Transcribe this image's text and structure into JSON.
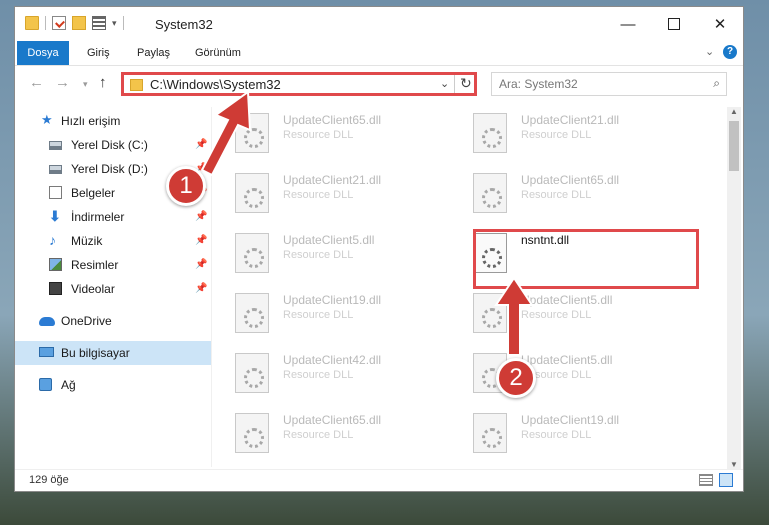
{
  "window": {
    "title": "System32"
  },
  "ribbon": {
    "tabs": [
      "Dosya",
      "Giriş",
      "Paylaş",
      "Görünüm"
    ],
    "help_label": "?"
  },
  "nav": {
    "address": "C:\\Windows\\System32",
    "search_placeholder": "Ara: System32"
  },
  "sidebar": {
    "quick_access": "Hızlı erişim",
    "items": [
      {
        "label": "Yerel Disk (C:)",
        "icon": "drive-icon"
      },
      {
        "label": "Yerel Disk (D:)",
        "icon": "drive-icon"
      },
      {
        "label": "Belgeler",
        "icon": "documents-icon"
      },
      {
        "label": "İndirmeler",
        "icon": "download-icon"
      },
      {
        "label": "Müzik",
        "icon": "music-icon"
      },
      {
        "label": "Resimler",
        "icon": "pictures-icon"
      },
      {
        "label": "Videolar",
        "icon": "videos-icon"
      }
    ],
    "onedrive": "OneDrive",
    "this_pc": "Bu bilgisayar",
    "network": "Ağ"
  },
  "files": {
    "left_column": [
      {
        "name": "UpdateClient65.dll",
        "type": "Resource DLL"
      },
      {
        "name": "UpdateClient21.dll",
        "type": "Resource DLL"
      },
      {
        "name": "UpdateClient5.dll",
        "type": "Resource DLL"
      },
      {
        "name": "UpdateClient19.dll",
        "type": "Resource DLL"
      },
      {
        "name": "UpdateClient42.dll",
        "type": "Resource DLL"
      },
      {
        "name": "UpdateClient65.dll",
        "type": "Resource DLL"
      }
    ],
    "right_column": [
      {
        "name": "UpdateClient21.dll",
        "type": "Resource DLL"
      },
      {
        "name": "UpdateClient65.dll",
        "type": "Resource DLL"
      },
      {
        "name": "nsntnt.dll",
        "type": ""
      },
      {
        "name": "UpdateClient5.dll",
        "type": "Resource DLL"
      },
      {
        "name": "UpdateClient5.dll",
        "type": "Resource DLL"
      },
      {
        "name": "UpdateClient19.dll",
        "type": "Resource DLL"
      }
    ]
  },
  "status": {
    "count": "129 öğe"
  },
  "callouts": [
    "1",
    "2"
  ],
  "colors": {
    "accent": "#1979ca",
    "highlight": "#e0494b",
    "callout": "#cf3b35"
  }
}
